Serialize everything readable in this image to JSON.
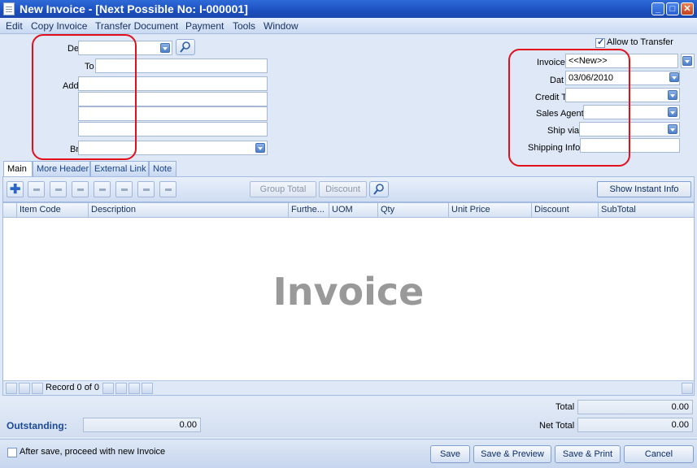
{
  "window": {
    "title": "New Invoice - [Next Possible No: I-000001]"
  },
  "menu": [
    "Edit",
    "Copy Invoice",
    "Transfer Document",
    "Payment",
    "Tools",
    "Window"
  ],
  "header_left": {
    "debtor_label": "De",
    "to_label": "To",
    "address_label": "Address",
    "branch_label": "Br"
  },
  "header_right": {
    "allow_transfer_label": "Allow to Transfer",
    "invoice_label": "Invoice",
    "invoice_value": "<<New>>",
    "date_label": "Dat",
    "date_value": "03/06/2010",
    "credit_term_label": "Credit T",
    "sales_agent_label": "Sales Agent",
    "ship_via_label": "Ship via",
    "shipping_info_label": "Shipping Info"
  },
  "tabs": [
    "Main",
    "More Header",
    "External Link",
    "Note"
  ],
  "toolbar": {
    "group_total_label": "Group Total",
    "discount_label": "Discount",
    "show_instant_info_label": "Show Instant Info"
  },
  "grid": {
    "columns": [
      "Item Code",
      "Description",
      "Furthe...",
      "UOM",
      "Qty",
      "Unit Price",
      "Discount",
      "SubTotal"
    ],
    "watermark": "Invoice",
    "record_text": "Record 0 of 0"
  },
  "totals": {
    "outstanding_label": "Outstanding:",
    "outstanding_value": "0.00",
    "total_label": "Total",
    "total_value": "0.00",
    "net_total_label": "Net Total",
    "net_total_value": "0.00"
  },
  "footer": {
    "after_save_label": "After save, proceed with new Invoice",
    "save_label": "Save",
    "save_preview_label": "Save & Preview",
    "save_print_label": "Save & Print",
    "cancel_label": "Cancel"
  },
  "colors": {
    "title_bar": "#1b4fbf",
    "highlight": "#e3101b",
    "accent_text": "#15428b"
  }
}
